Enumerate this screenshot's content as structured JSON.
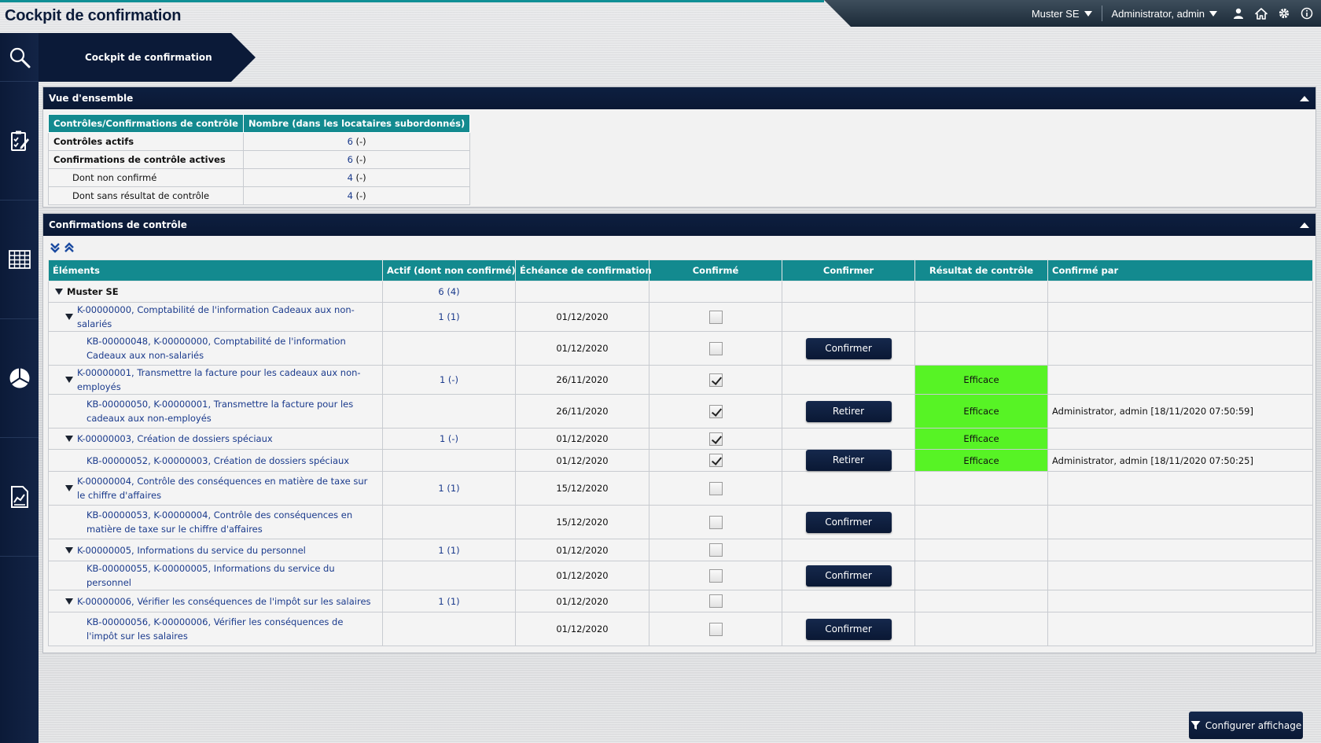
{
  "app_title": "Cockpit de confirmation",
  "topbar": {
    "tenant": "Muster SE",
    "user": "Administrator, admin"
  },
  "breadcrumb": "Cockpit de confirmation",
  "overview": {
    "title": "Vue d'ensemble",
    "headers": [
      "Contrôles/Confirmations de contrôle",
      "Nombre (dans les locataires subordonnés)"
    ],
    "rows": [
      {
        "label": "Contrôles actifs",
        "link": "6",
        "suffix": " (-)"
      },
      {
        "label": "Confirmations de contrôle actives",
        "link": "6",
        "suffix": " (-)"
      },
      {
        "label": "Dont non confirmé",
        "link": "4",
        "suffix": " (-)"
      },
      {
        "label": "Dont sans résultat de contrôle",
        "link": "4",
        "suffix": " (-)"
      }
    ]
  },
  "confirmations": {
    "title": "Confirmations de contrôle",
    "headers": {
      "elements": "Éléments",
      "active": "Actif (dont non confirmé)",
      "due": "Échéance de confirmation",
      "confirmed": "Confirmé",
      "confirm": "Confirmer",
      "result": "Résultat de contrôle",
      "confirmed_by": "Confirmé par"
    },
    "rows": [
      {
        "level": 0,
        "text": "Muster SE",
        "active": "6 (4)",
        "due": "",
        "checkbox": false,
        "checked": false,
        "button": "",
        "result": "",
        "by": ""
      },
      {
        "level": 1,
        "text": "K-00000000, Comptabilité de l'information Cadeaux aux non-salariés",
        "active": "1 (1)",
        "due": "01/12/2020",
        "checkbox": true,
        "checked": false,
        "button": "",
        "result": "",
        "by": ""
      },
      {
        "level": 2,
        "text": "KB-00000048, K-00000000, Comptabilité de l'information Cadeaux aux non-salariés",
        "active": "",
        "due": "01/12/2020",
        "checkbox": true,
        "checked": false,
        "button": "Confirmer",
        "result": "",
        "by": ""
      },
      {
        "level": 1,
        "text": "K-00000001, Transmettre la facture pour les cadeaux aux non-employés",
        "active": "1 (-)",
        "due": "26/11/2020",
        "checkbox": true,
        "checked": true,
        "button": "",
        "result": "Efficace",
        "by": ""
      },
      {
        "level": 2,
        "text": "KB-00000050, K-00000001, Transmettre la facture pour les cadeaux aux non-employés",
        "active": "",
        "due": "26/11/2020",
        "checkbox": true,
        "checked": true,
        "button": "Retirer",
        "result": "Efficace",
        "by": "Administrator, admin [18/11/2020 07:50:59]"
      },
      {
        "level": 1,
        "text": "K-00000003, Création de dossiers spéciaux",
        "active": "1 (-)",
        "due": "01/12/2020",
        "checkbox": true,
        "checked": true,
        "button": "",
        "result": "Efficace",
        "by": ""
      },
      {
        "level": 2,
        "text": "KB-00000052, K-00000003, Création de dossiers spéciaux",
        "active": "",
        "due": "01/12/2020",
        "checkbox": true,
        "checked": true,
        "button": "Retirer",
        "result": "Efficace",
        "by": "Administrator, admin [18/11/2020 07:50:25]"
      },
      {
        "level": 1,
        "text": "K-00000004, Contrôle des conséquences en matière de taxe sur le chiffre d'affaires",
        "active": "1 (1)",
        "due": "15/12/2020",
        "checkbox": true,
        "checked": false,
        "button": "",
        "result": "",
        "by": ""
      },
      {
        "level": 2,
        "text": "KB-00000053, K-00000004, Contrôle des conséquences en matière de taxe sur le chiffre d'affaires",
        "active": "",
        "due": "15/12/2020",
        "checkbox": true,
        "checked": false,
        "button": "Confirmer",
        "result": "",
        "by": ""
      },
      {
        "level": 1,
        "text": "K-00000005, Informations du service du personnel",
        "active": "1 (1)",
        "due": "01/12/2020",
        "checkbox": true,
        "checked": false,
        "button": "",
        "result": "",
        "by": ""
      },
      {
        "level": 2,
        "text": "KB-00000055, K-00000005, Informations du service du personnel",
        "active": "",
        "due": "01/12/2020",
        "checkbox": true,
        "checked": false,
        "button": "Confirmer",
        "result": "",
        "by": ""
      },
      {
        "level": 1,
        "text": "K-00000006, Vérifier les conséquences de l'impôt sur les salaires",
        "active": "1 (1)",
        "due": "01/12/2020",
        "checkbox": true,
        "checked": false,
        "button": "",
        "result": "",
        "by": ""
      },
      {
        "level": 2,
        "text": "KB-00000056, K-00000006, Vérifier les conséquences de l'impôt sur les salaires",
        "active": "",
        "due": "01/12/2020",
        "checkbox": true,
        "checked": false,
        "button": "Confirmer",
        "result": "",
        "by": ""
      }
    ]
  },
  "configure_button": "Configurer affichage",
  "colors": {
    "navy": "#0b1a38",
    "teal_header": "#138a8f",
    "effective_green": "#57f325",
    "link_blue": "#1a3a8c"
  },
  "icons": [
    "search-icon",
    "checklist-icon",
    "calendar-grid-icon",
    "pie-chart-icon",
    "report-icon",
    "home-icon",
    "gear-icon",
    "info-icon",
    "user-icon",
    "expand-all-icon",
    "collapse-all-icon",
    "filter-icon"
  ]
}
